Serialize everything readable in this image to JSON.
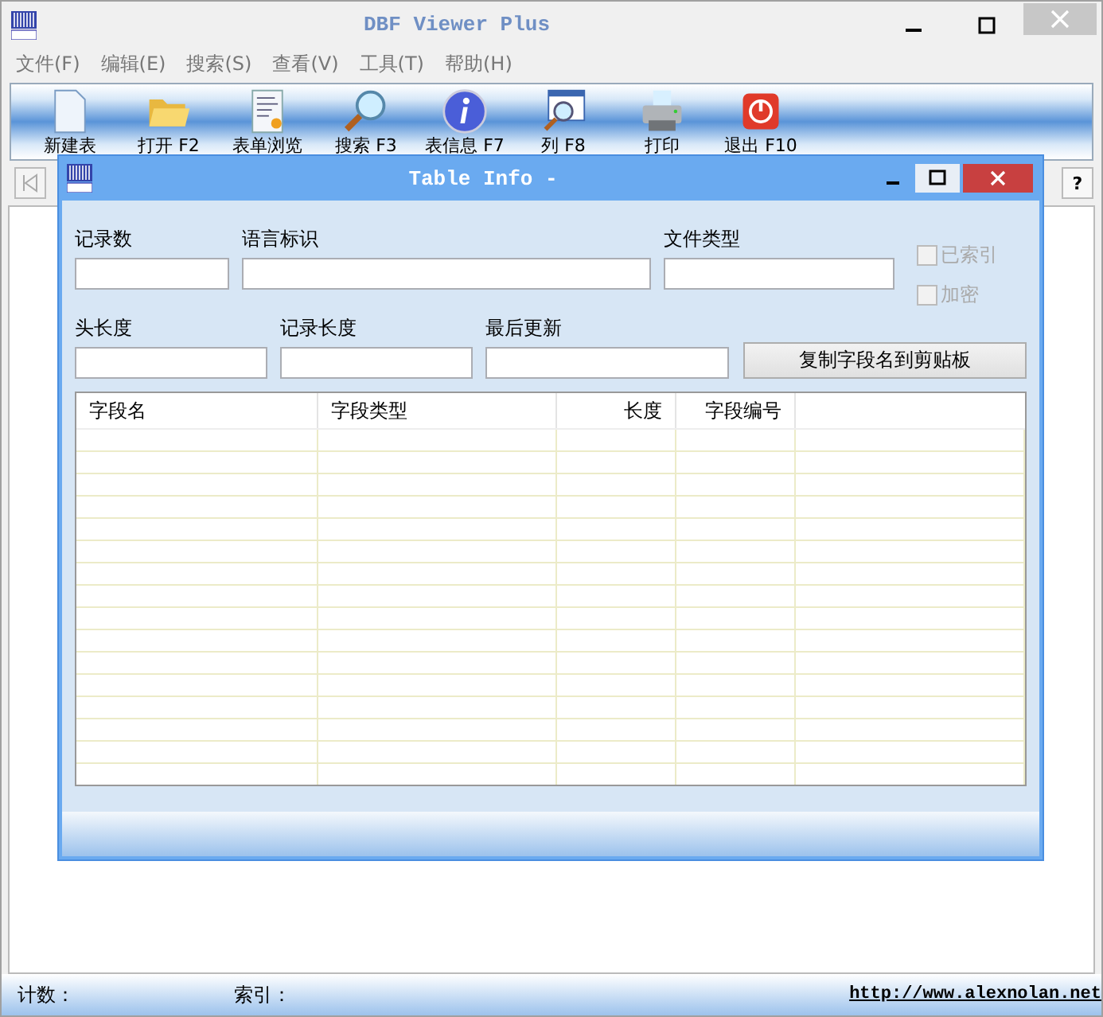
{
  "window": {
    "title": "DBF Viewer Plus"
  },
  "menu": [
    "文件(F)",
    "编辑(E)",
    "搜索(S)",
    "查看(V)",
    "工具(T)",
    "帮助(H)"
  ],
  "toolbar": [
    {
      "label": "新建表",
      "kind": "new"
    },
    {
      "label": "打开 F2",
      "kind": "open"
    },
    {
      "label": "表单浏览",
      "kind": "form"
    },
    {
      "label": "搜索 F3",
      "kind": "search"
    },
    {
      "label": "表信息 F7",
      "kind": "info"
    },
    {
      "label": "列 F8",
      "kind": "columns"
    },
    {
      "label": "打印",
      "kind": "print"
    },
    {
      "label": "退出 F10",
      "kind": "exit"
    }
  ],
  "nav": {
    "help_button": "?"
  },
  "dialog": {
    "title": "Table Info -",
    "fields_row1": [
      {
        "label": "记录数"
      },
      {
        "label": "语言标识"
      },
      {
        "label": "文件类型"
      }
    ],
    "checkboxes": [
      {
        "label": "已索引",
        "checked": false,
        "disabled": true
      },
      {
        "label": "加密",
        "checked": false,
        "disabled": true
      }
    ],
    "fields_row2": [
      {
        "label": "头长度"
      },
      {
        "label": "记录长度"
      },
      {
        "label": "最后更新"
      }
    ],
    "copy_button": "复制字段名到剪贴板",
    "table": {
      "columns": [
        "字段名",
        "字段类型",
        "长度",
        "字段编号"
      ]
    }
  },
  "status_bar": {
    "count_label": "计数：",
    "index_label": "索引：",
    "link": "http://www.alexnolan.net"
  }
}
